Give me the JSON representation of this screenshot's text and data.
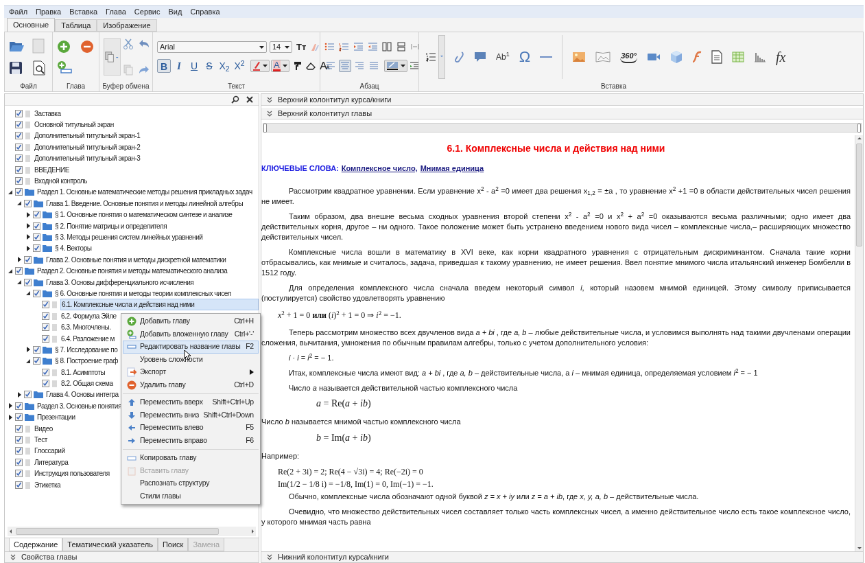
{
  "menu_bar": [
    "Файл",
    "Правка",
    "Вставка",
    "Глава",
    "Сервис",
    "Вид",
    "Справка"
  ],
  "ribbon_tabs": [
    {
      "label": "Основные",
      "selected": true
    },
    {
      "label": "Таблица",
      "selected": false
    },
    {
      "label": "Изображение",
      "selected": false
    }
  ],
  "ribbon": {
    "groups": [
      "Файл",
      "Глава",
      "Буфер обмена",
      "Текст",
      "Абзац",
      "Вставка"
    ],
    "font": "Arial",
    "font_size": "14",
    "case_button": "Тт",
    "format_buttons": [
      {
        "label": "B",
        "selected": true
      },
      {
        "label": "I",
        "selected": false
      },
      {
        "label": "U",
        "selected": false
      },
      {
        "label": "S",
        "selected": false
      },
      {
        "label": "X$_{2}$",
        "selected": false
      },
      {
        "label": "X$^{2}$",
        "selected": false
      }
    ],
    "font_color_button": "A",
    "align_buttons": [
      {
        "selected": false
      },
      {
        "selected": true
      },
      {
        "selected": false
      },
      {
        "selected": false
      }
    ],
    "insert_labels": [
      "Ab$^{1}$",
      "Ω",
      "360°",
      "fx"
    ]
  },
  "tree": [
    {
      "label": "Заставка",
      "kind": "doc",
      "checked": true,
      "selected": false
    },
    {
      "label": "Основной титульный экран",
      "kind": "doc",
      "checked": true,
      "selected": false
    },
    {
      "label": "Дополнительный титульный экран-1",
      "kind": "doc",
      "checked": true,
      "selected": false
    },
    {
      "label": "Дополнительный титульный экран-2",
      "kind": "doc",
      "checked": true,
      "selected": false
    },
    {
      "label": "Дополнительный титульный экран-3",
      "kind": "doc",
      "checked": true,
      "selected": false
    },
    {
      "label": "ВВЕДЕНИЕ",
      "kind": "doc",
      "checked": true,
      "selected": false
    },
    {
      "label": "Входной контроль",
      "kind": "doc",
      "checked": true,
      "selected": false
    },
    {
      "label": "Раздел 1. Основные математические методы решения прикладных задач",
      "kind": "folder",
      "checked": true,
      "selected": false,
      "expanded": true,
      "children": [
        {
          "label": "Глава 1.  Введение. Основные понятия и методы линейной алгебры",
          "kind": "folder",
          "checked": true,
          "selected": false,
          "expanded": true,
          "children": [
            {
              "label": "§ 1. Основные понятия о математическом синтезе и анализе",
              "kind": "folder",
              "checked": true,
              "selected": false,
              "expanded": false
            },
            {
              "label": "§ 2. Понятие матрицы и определителя",
              "kind": "folder",
              "checked": true,
              "selected": false,
              "expanded": false
            },
            {
              "label": "§ 3. Методы решения систем линейных уравнений",
              "kind": "folder",
              "checked": true,
              "selected": false,
              "expanded": false
            },
            {
              "label": "§ 4. Векторы",
              "kind": "folder",
              "checked": true,
              "selected": false,
              "expanded": false
            }
          ]
        },
        {
          "label": "Глава 2. Основные понятия и методы дискретной математики",
          "kind": "folder",
          "checked": true,
          "selected": false,
          "expanded": false
        }
      ]
    },
    {
      "label": "Раздел 2. Основные понятия и методы математического анализа",
      "kind": "folder",
      "checked": true,
      "selected": false,
      "expanded": true,
      "children": [
        {
          "label": "Глава 3. Основы дифференциального исчисления",
          "kind": "folder",
          "checked": true,
          "selected": false,
          "expanded": true,
          "children": [
            {
              "label": "§ 6. Основные понятия и методы теории комплексных чисел",
              "kind": "folder",
              "checked": true,
              "selected": false,
              "expanded": true,
              "children": [
                {
                  "label": "6.1. Комплексные числа и действия над ними",
                  "kind": "doc",
                  "checked": true,
                  "selected": true
                },
                {
                  "label": "6.2. Формула Эйле",
                  "kind": "doc",
                  "checked": true,
                  "selected": false
                },
                {
                  "label": "6.3. Многочлены.",
                  "kind": "doc",
                  "checked": true,
                  "selected": false
                },
                {
                  "label": "6.4. Разложение м",
                  "kind": "doc",
                  "checked": true,
                  "selected": false
                }
              ]
            },
            {
              "label": "§ 7. Исследование по",
              "kind": "folder",
              "checked": true,
              "selected": false,
              "expanded": false
            },
            {
              "label": "§ 8. Построение граф",
              "kind": "folder",
              "checked": true,
              "selected": false,
              "expanded": true,
              "children": [
                {
                  "label": "8.1. Асимптоты",
                  "kind": "doc",
                  "checked": true,
                  "selected": false
                },
                {
                  "label": "8.2. Общая схема",
                  "kind": "doc",
                  "checked": true,
                  "selected": false
                }
              ]
            }
          ]
        },
        {
          "label": "Глава 4. Основы интегра",
          "kind": "folder",
          "checked": true,
          "selected": false,
          "expanded": false
        }
      ]
    },
    {
      "label": "Раздел 3. Основные понятия",
      "kind": "folder",
      "checked": true,
      "selected": false,
      "expanded": false
    },
    {
      "label": "Презентации",
      "kind": "folder",
      "checked": true,
      "selected": false,
      "expanded": false
    },
    {
      "label": "Видео",
      "kind": "doc",
      "checked": true,
      "selected": false
    },
    {
      "label": "Тест",
      "kind": "doc",
      "checked": true,
      "selected": false
    },
    {
      "label": "Глоссарий",
      "kind": "doc",
      "checked": true,
      "selected": false
    },
    {
      "label": "Литература",
      "kind": "doc",
      "checked": true,
      "selected": false
    },
    {
      "label": "Инструкция пользователя",
      "kind": "doc",
      "checked": true,
      "selected": false
    },
    {
      "label": "Этикетка",
      "kind": "doc",
      "checked": true,
      "selected": false
    }
  ],
  "panel_tabs": [
    {
      "label": "Содержание",
      "selected": true,
      "disabled": false
    },
    {
      "label": "Тематический указатель",
      "selected": false,
      "disabled": false
    },
    {
      "label": "Поиск",
      "selected": false,
      "disabled": false
    },
    {
      "label": "Замена",
      "selected": false,
      "disabled": true
    }
  ],
  "properties_bar": "Свойства главы",
  "context_menu": [
    [
      {
        "label": "Добавить главу",
        "shortcut": "Ctrl+H",
        "selected": false,
        "disabled": false,
        "submenu": false
      },
      {
        "label": "Добавить вложенную главу",
        "shortcut": "Ctrl+'-'",
        "selected": false,
        "disabled": false,
        "submenu": false
      },
      {
        "label": "Редактировать название главы",
        "shortcut": "F2",
        "selected": true,
        "disabled": false,
        "submenu": false
      },
      {
        "label": "Уровень сложности",
        "selected": false,
        "disabled": false,
        "submenu": false
      },
      {
        "label": "Экспорт",
        "selected": false,
        "disabled": false,
        "submenu": true
      },
      {
        "label": "Удалить главу",
        "shortcut": "Ctrl+D",
        "selected": false,
        "disabled": false,
        "submenu": false
      }
    ],
    [
      {
        "label": "Переместить вверх",
        "shortcut": "Shift+Ctrl+Up",
        "selected": false,
        "disabled": false,
        "submenu": false
      },
      {
        "label": "Переместить вниз",
        "shortcut": "Shift+Ctrl+Down",
        "selected": false,
        "disabled": false,
        "submenu": false
      },
      {
        "label": "Переместить влево",
        "shortcut": "F5",
        "selected": false,
        "disabled": false,
        "submenu": false
      },
      {
        "label": "Переместить вправо",
        "shortcut": "F6",
        "selected": false,
        "disabled": false,
        "submenu": false
      }
    ],
    [
      {
        "label": "Копировать главу",
        "selected": false,
        "disabled": false,
        "submenu": false
      },
      {
        "label": "Вставить главу",
        "selected": false,
        "disabled": true,
        "submenu": false
      },
      {
        "label": "Распознать структуру",
        "selected": false,
        "disabled": false,
        "submenu": false
      },
      {
        "label": "Стили главы",
        "selected": false,
        "disabled": false,
        "submenu": false
      }
    ]
  ],
  "header_bars": [
    "Верхний колонтитул курса/книги",
    "Верхний колонтитул главы"
  ],
  "document": {
    "title": "6.1. Комплексные числа и действия над ними",
    "keywords_label": "КЛЮЧЕВЫЕ СЛОВА:",
    "keywords": [
      "Комплексное число,",
      "Мнимая единица"
    ],
    "blocks": [
      {
        "kind": "paragraph",
        "text": "Рассмотрим квадратное уравнении.  Если уравнение x$^{2}$ - a$^{2}$ =0   имеет два решения x$_{1,2}$ = ±a , то уравнение x$^{2}$ +1 =0  в области действительных чисел решения не имеет."
      },
      {
        "kind": "paragraph",
        "text": "Таким образом, два внешне весьма сходных уравнения второй степени x$^{2}$ - a$^{2}$ =0 и x$^{2}$ + a$^{2}$ =0  оказываются весьма различными; одно имеет два действительных корня, другое – ни одного. Такое положение может быть устранено введением нового вида чисел – комплексные числа,– расширяющих множество действительных чисел."
      },
      {
        "kind": "paragraph",
        "text": "Комплексные числа вошли в математику в XVI веке, как корни квадратного уравнения с отрицательным дискриминантом. Сначала такие корни отбрасывались, как мнимые и считалось, задача, приведшая к такому уравнению, не имеет решения. Ввел понятие мнимого числа итальянский инженер Бомбелли в 1512 году."
      },
      {
        "kind": "paragraph",
        "text": "Для определения комплексного числа сначала введем некоторый символ *i*, который назовем мнимой единицей. Этому символу приписывается (постулируется) свойство удовлетворять уравнению"
      },
      {
        "kind": "formula",
        "text": "*x*$^{2}$ + 1 = 0  **или**  (*i*)$^{2}$ + 1 = 0   ⇒ *i*$^{2}$ = −1."
      },
      {
        "kind": "paragraph",
        "text": "Теперь рассмотрим множество всех двучленов вида *a + bi* , где *a, b* – любые действительные числа, и условимся выполнять над такими двучленами операции сложения, вычитания, умножения по обычным правилам алгебры, только с учетом дополнительного условия:"
      },
      {
        "kind": "equation",
        "text": "*i* · *i* = *i*$^{2}$ = − 1."
      },
      {
        "kind": "paragraph",
        "text": "Итак, комплексные числа имеют вид: *a + bi* , где *a, b* – действительные числа, а *i* – мнимая единица, определяемая условием *i*$^{2}$ = − 1"
      },
      {
        "kind": "equation",
        "text": "Число *a* называется действительной частью комплексного числа"
      },
      {
        "kind": "formula",
        "text": "*a* = Re(*a* + *ib*)"
      },
      {
        "kind": "plain",
        "text": "Число *b* называется мнимой частью комплексного числа"
      },
      {
        "kind": "formula",
        "text": "*b* = Im(*a* + *ib*)"
      },
      {
        "kind": "plain",
        "text": "Например:"
      },
      {
        "kind": "example",
        "text": "Re(2 + 3i) = 2;   Re(4 − √3i) = 4;   Re(−2i) = 0"
      },
      {
        "kind": "example",
        "text": "Im(1/2 − 1/8 i) = −1/8,   Im(1) = 0,   Im(−1) = −1."
      },
      {
        "kind": "paragraph",
        "text": "Обычно, комплексные числа обозначают одной буквой *z = x + iy* или *z = a + ib*, где *x, y, a, b* – действительные числа."
      },
      {
        "kind": "paragraph",
        "text": "Очевидно, что множество действительных чисел составляет только часть комплексных чисел, а именно действительное число есть такое комплексное число, у которого мнимая часть равна"
      }
    ]
  },
  "footer_bar": "Нижний колонтитул курса/книги"
}
